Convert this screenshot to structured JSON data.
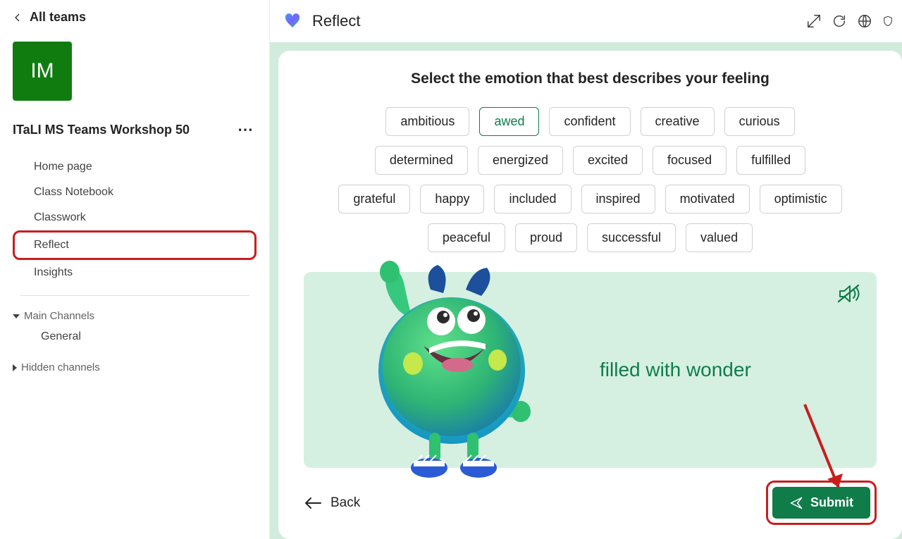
{
  "sidebar": {
    "back_label": "All teams",
    "avatar_initials": "IM",
    "team_name": "ITaLI MS Teams Workshop 50",
    "nav_items": [
      "Home page",
      "Class Notebook",
      "Classwork",
      "Reflect",
      "Insights"
    ],
    "highlighted_index": 3,
    "sections": {
      "main_channels_label": "Main Channels",
      "general_label": "General",
      "hidden_channels_label": "Hidden channels"
    }
  },
  "topbar": {
    "app_name": "Reflect"
  },
  "reflect": {
    "prompt": "Select the emotion that best describes your feeling",
    "emotions": [
      "ambitious",
      "awed",
      "confident",
      "creative",
      "curious",
      "determined",
      "energized",
      "excited",
      "focused",
      "fulfilled",
      "grateful",
      "happy",
      "included",
      "inspired",
      "motivated",
      "optimistic",
      "peaceful",
      "proud",
      "successful",
      "valued"
    ],
    "selected_emotion": "awed",
    "feeling_description": "filled with wonder",
    "back_label": "Back",
    "submit_label": "Submit"
  },
  "colors": {
    "accent_green": "#107c4a",
    "annotation_red": "#c81e1e"
  }
}
